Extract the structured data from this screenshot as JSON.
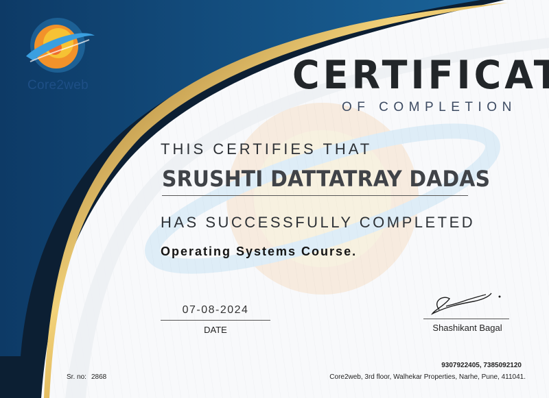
{
  "brand": {
    "name": "Core2web"
  },
  "certificate": {
    "title": "CERTIFICATE",
    "subtitle": "OF COMPLETION",
    "certifies": "THIS CERTIFIES THAT",
    "recipient": "SRUSHTI DATTATRAY DADAS",
    "completed": "HAS SUCCESSFULLY COMPLETED",
    "course": "Operating Systems Course."
  },
  "date": {
    "value": "07-08-2024",
    "label": "DATE"
  },
  "signature": {
    "script": "Shashi Bagal",
    "name": "Shashikant Bagal"
  },
  "footer": {
    "phones": "9307922405, 7385092120",
    "address": "Core2web, 3rd floor, Walhekar Properties, Narhe, Pune, 411041.",
    "sr_label": "Sr. no:",
    "sr_value": "2868"
  },
  "colors": {
    "navy": "#0c1f33",
    "blue": "#114b79",
    "gold": "#d3a43c",
    "logo_orange": "#f2922a",
    "logo_yellow": "#f6c234",
    "logo_blue": "#3a9fe0"
  }
}
